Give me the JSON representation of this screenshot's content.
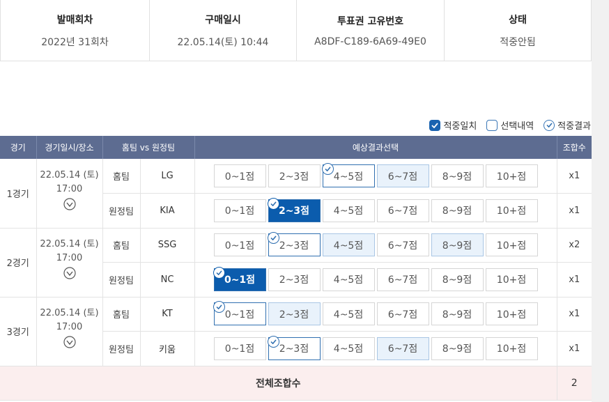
{
  "summary": {
    "headers": [
      "발매회차",
      "구매일시",
      "투표권 고유번호",
      "상태"
    ],
    "values": [
      "2022년 31회차",
      "22.05.14(토) 10:44",
      "A8DF-C189-6A69-49E0",
      "적중안됨"
    ]
  },
  "legend": {
    "match": "적중일치",
    "selected": "선택내역",
    "result": "적중결과"
  },
  "table": {
    "headers": [
      "경기",
      "경기일시/장소",
      "홈팀 vs 원정팀",
      "예상결과선택",
      "조합수"
    ],
    "games": [
      {
        "name": "1경기",
        "date": "22.05.14 (토)",
        "time": "17:00",
        "rows": [
          {
            "type": "홈팀",
            "team": "LG",
            "combo": "x1",
            "options": [
              {
                "label": "0~1점",
                "state": "normal",
                "result": false
              },
              {
                "label": "2~3점",
                "state": "normal",
                "result": false
              },
              {
                "label": "4~5점",
                "state": "normal",
                "result": true
              },
              {
                "label": "6~7점",
                "state": "selected",
                "result": false
              },
              {
                "label": "8~9점",
                "state": "normal",
                "result": false
              },
              {
                "label": "10+점",
                "state": "normal",
                "result": false
              }
            ]
          },
          {
            "type": "원정팀",
            "team": "KIA",
            "combo": "x1",
            "options": [
              {
                "label": "0~1점",
                "state": "normal",
                "result": false
              },
              {
                "label": "2~3점",
                "state": "match",
                "result": true
              },
              {
                "label": "4~5점",
                "state": "normal",
                "result": false
              },
              {
                "label": "6~7점",
                "state": "normal",
                "result": false
              },
              {
                "label": "8~9점",
                "state": "normal",
                "result": false
              },
              {
                "label": "10+점",
                "state": "normal",
                "result": false
              }
            ]
          }
        ]
      },
      {
        "name": "2경기",
        "date": "22.05.14 (토)",
        "time": "17:00",
        "rows": [
          {
            "type": "홈팀",
            "team": "SSG",
            "combo": "x2",
            "options": [
              {
                "label": "0~1점",
                "state": "normal",
                "result": false
              },
              {
                "label": "2~3점",
                "state": "normal",
                "result": true
              },
              {
                "label": "4~5점",
                "state": "selected",
                "result": false
              },
              {
                "label": "6~7점",
                "state": "normal",
                "result": false
              },
              {
                "label": "8~9점",
                "state": "selected",
                "result": false
              },
              {
                "label": "10+점",
                "state": "normal",
                "result": false
              }
            ]
          },
          {
            "type": "원정팀",
            "team": "NC",
            "combo": "x1",
            "options": [
              {
                "label": "0~1점",
                "state": "match",
                "result": true
              },
              {
                "label": "2~3점",
                "state": "normal",
                "result": false
              },
              {
                "label": "4~5점",
                "state": "normal",
                "result": false
              },
              {
                "label": "6~7점",
                "state": "normal",
                "result": false
              },
              {
                "label": "8~9점",
                "state": "normal",
                "result": false
              },
              {
                "label": "10+점",
                "state": "normal",
                "result": false
              }
            ]
          }
        ]
      },
      {
        "name": "3경기",
        "date": "22.05.14 (토)",
        "time": "17:00",
        "rows": [
          {
            "type": "홈팀",
            "team": "KT",
            "combo": "x1",
            "options": [
              {
                "label": "0~1점",
                "state": "normal",
                "result": true
              },
              {
                "label": "2~3점",
                "state": "selected",
                "result": false
              },
              {
                "label": "4~5점",
                "state": "normal",
                "result": false
              },
              {
                "label": "6~7점",
                "state": "normal",
                "result": false
              },
              {
                "label": "8~9점",
                "state": "normal",
                "result": false
              },
              {
                "label": "10+점",
                "state": "normal",
                "result": false
              }
            ]
          },
          {
            "type": "원정팀",
            "team": "키움",
            "combo": "x1",
            "options": [
              {
                "label": "0~1점",
                "state": "normal",
                "result": false
              },
              {
                "label": "2~3점",
                "state": "normal",
                "result": true
              },
              {
                "label": "4~5점",
                "state": "normal",
                "result": false
              },
              {
                "label": "6~7점",
                "state": "selected",
                "result": false
              },
              {
                "label": "8~9점",
                "state": "normal",
                "result": false
              },
              {
                "label": "10+점",
                "state": "normal",
                "result": false
              }
            ]
          }
        ]
      }
    ],
    "total_label": "전체조합수",
    "total_value": "2"
  },
  "colors": {
    "header_bg": "#5d6c91",
    "match_bg": "#0b5cad",
    "selected_bg": "#e9f2fb",
    "total_bg": "#fbeeee"
  }
}
